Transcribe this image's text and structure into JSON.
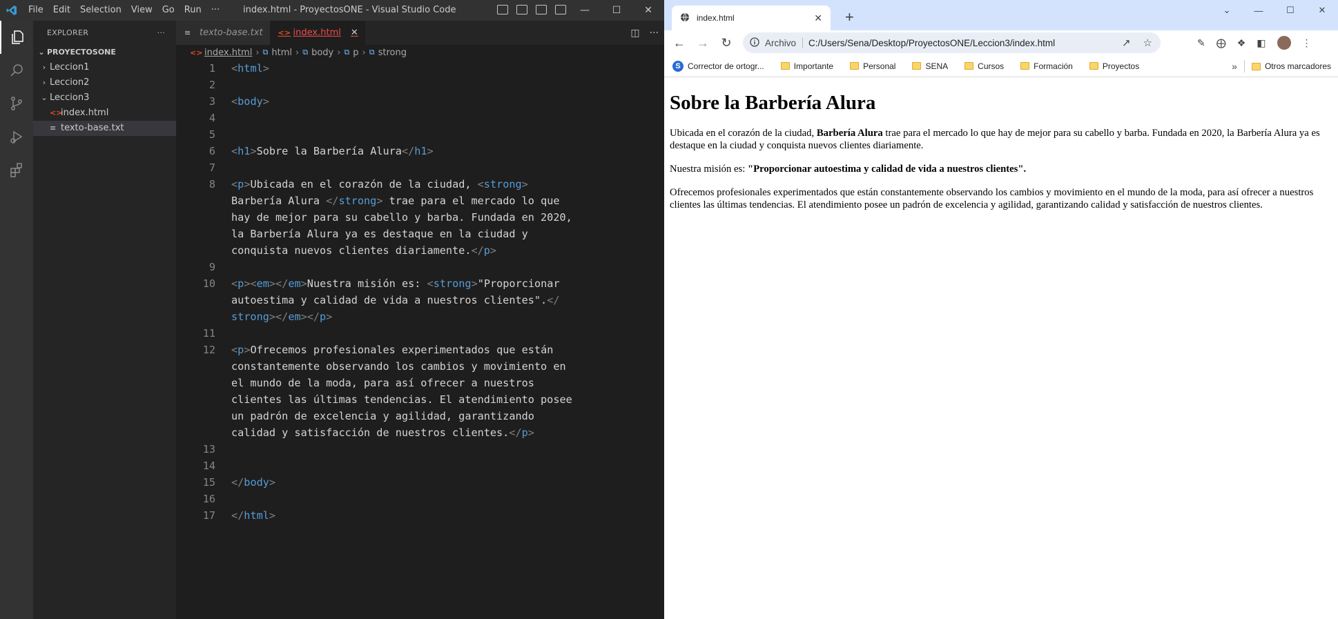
{
  "vscode": {
    "menu": [
      "File",
      "Edit",
      "Selection",
      "View",
      "Go",
      "Run",
      "···"
    ],
    "window_title": "index.html - ProyectosONE - Visual Studio Code",
    "explorer": {
      "header": "EXPLORER",
      "more": "···",
      "root": "PROYECTOSONE",
      "items": [
        {
          "label": "Leccion1",
          "type": "folder",
          "expanded": false
        },
        {
          "label": "Leccion2",
          "type": "folder",
          "expanded": false
        },
        {
          "label": "Leccion3",
          "type": "folder",
          "expanded": true
        },
        {
          "label": "index.html",
          "type": "html"
        },
        {
          "label": "texto-base.txt",
          "type": "txt"
        }
      ]
    },
    "tabs": [
      {
        "label": "texto-base.txt",
        "active": false
      },
      {
        "label": "index.html",
        "active": true
      }
    ],
    "breadcrumb": [
      "index.html",
      "html",
      "body",
      "p",
      "strong"
    ],
    "line_numbers": [
      "1",
      "2",
      "3",
      "4",
      "5",
      "6",
      "7",
      "8",
      "",
      "",
      "",
      "",
      "9",
      "10",
      "",
      "",
      "11",
      "12",
      "",
      "",
      "",
      "",
      "",
      "13",
      "14",
      "15",
      "16",
      "17"
    ]
  },
  "chrome": {
    "tab_title": "index.html",
    "omnibox_label": "Archivo",
    "url": "C:/Users/Sena/Desktop/ProyectosONE/Leccion3/index.html",
    "bookmarks": [
      "Corrector de ortogr...",
      "Importante",
      "Personal",
      "SENA",
      "Cursos",
      "Formación",
      "Proyectos"
    ],
    "other_bookmarks": "Otros marcadores",
    "page": {
      "h1": "Sobre la Barbería Alura",
      "p1_a": "Ubicada en el corazón de la ciudad, ",
      "p1_strong": "Barbería Alura",
      "p1_b": " trae para el mercado lo que hay de mejor para su cabello y barba. Fundada en 2020, la Barbería Alura ya es destaque en la ciudad y conquista nuevos clientes diariamente.",
      "p2_a": "Nuestra misión es: ",
      "p2_strong": "\"Proporcionar autoestima y calidad de vida a nuestros clientes\".",
      "p3": "Ofrecemos profesionales experimentados que están constantemente observando los cambios y movimiento en el mundo de la moda, para así ofrecer a nuestros clientes las últimas tendencias. El atendimiento posee un padrón de excelencia y agilidad, garantizando calidad y satisfacción de nuestros clientes."
    }
  }
}
